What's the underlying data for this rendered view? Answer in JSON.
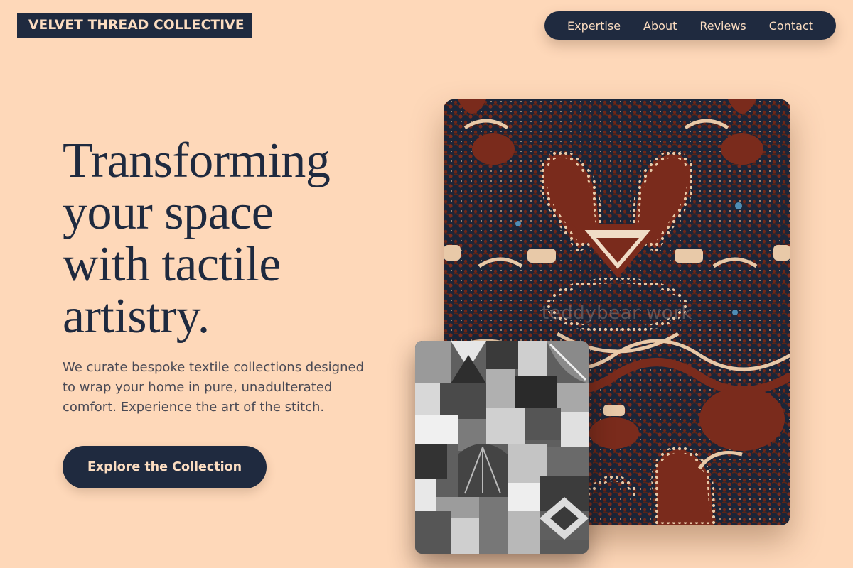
{
  "brand": {
    "name": "VELVET THREAD COLLECTIVE"
  },
  "nav": {
    "items": [
      {
        "label": "Expertise"
      },
      {
        "label": "About"
      },
      {
        "label": "Reviews"
      },
      {
        "label": "Contact"
      }
    ]
  },
  "hero": {
    "headline_lines": [
      "Transforming",
      "your space",
      "with tactile",
      "artistry."
    ],
    "subtext_lines": [
      "We curate bespoke textile collections designed",
      "to wrap your home in pure, unadulterated",
      "comfort. Experience the art of the stitch."
    ],
    "cta_label": "Explore the Collection"
  },
  "images": {
    "primary": {
      "subject": "batik textile pattern",
      "watermark": "teddybear work"
    },
    "secondary": {
      "subject": "black and white crazy quilt patchwork"
    }
  },
  "colors": {
    "background": "#fed8b9",
    "navy": "#1f2a3f",
    "cream": "#fbdcc0",
    "body_text": "#4a4a55",
    "batik_rust": "#7a2b1c",
    "batik_navy": "#1b2538"
  }
}
